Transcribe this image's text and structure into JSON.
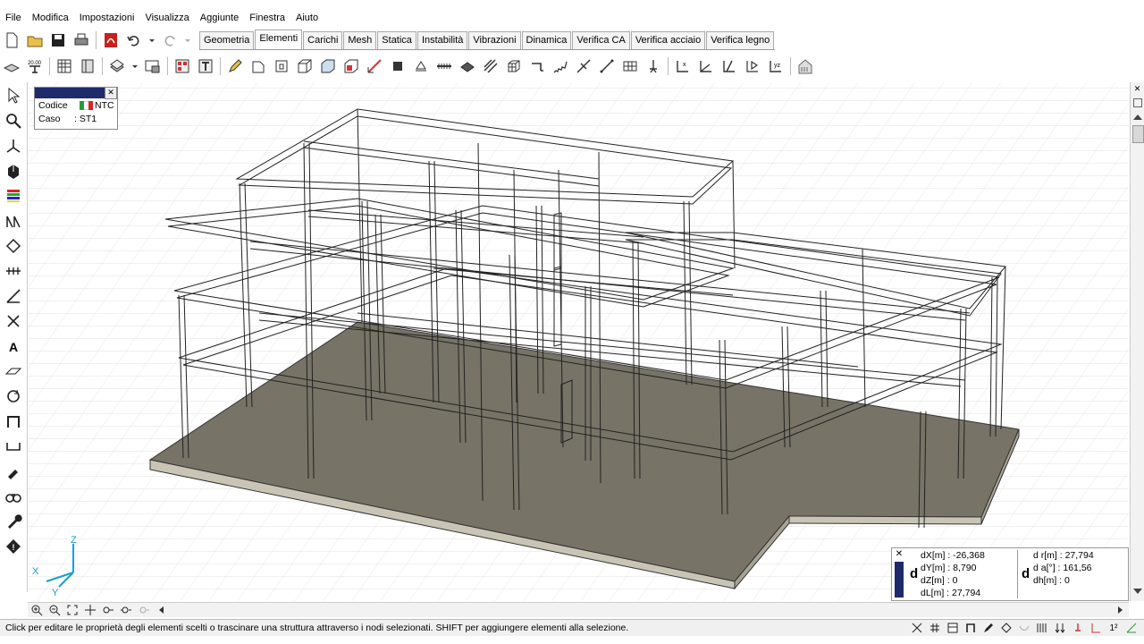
{
  "menu": [
    "File",
    "Modifica",
    "Impostazioni",
    "Visualizza",
    "Aggiunte",
    "Finestra",
    "Aiuto"
  ],
  "tabs": [
    "Geometria",
    "Elementi",
    "Carichi",
    "Mesh",
    "Statica",
    "Instabilità",
    "Vibrazioni",
    "Dinamica",
    "Verifica CA",
    "Verifica acciaio",
    "Verifica legno"
  ],
  "active_tab": "Elementi",
  "toolbar": {
    "scale_label": "20.00"
  },
  "case_panel": {
    "codice_label": "Codice",
    "norm": "NTC",
    "caso_label": "Caso",
    "caso_value": ": ST1"
  },
  "axes": {
    "x": "X",
    "y": "Y",
    "z": "Z"
  },
  "coords": {
    "left_symbol": "d",
    "dx": "dX[m] : -26,368",
    "dy": "dY[m] : 8,790",
    "dz": "dZ[m] : 0",
    "dl": "dL[m] : 27,794",
    "right_symbol": "d",
    "dr": "d r[m] : 27,794",
    "da": "d a[°] : 161,56",
    "dh": "dh[m] : 0"
  },
  "status_text": "Click per editare le proprietà degli elementi scelti o trascinare una struttura attraverso i nodi selezionati. SHIFT per aggiungere elementi alla selezione.",
  "status_num": "1²",
  "colors": {
    "slab": "#777366",
    "frame_stroke": "#222222",
    "grid": "#dcdcdc",
    "panel_title": "#1f2a6b"
  }
}
